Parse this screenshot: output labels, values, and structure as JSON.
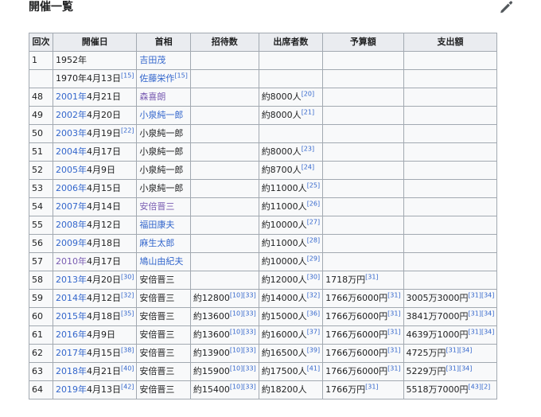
{
  "heading": "開催一覧",
  "edit_icon": "pencil-icon",
  "colors": {
    "link": "#3366cc",
    "visited": "#795cb2",
    "header_bg": "#eaecf0",
    "cell_bg": "#f8f9fa",
    "border": "#a2a9b1"
  },
  "headers": [
    "回次",
    "開催日",
    "首相",
    "招待数",
    "出席者数",
    "予算額",
    "支出額"
  ],
  "rows": [
    {
      "no": "1",
      "date": [
        {
          "t": "1952年"
        }
      ],
      "pm": {
        "t": "吉田茂",
        "c": "l-blue"
      }
    },
    {
      "no": "",
      "date": [
        {
          "t": "1970年4月13日"
        },
        {
          "s": "[15]"
        }
      ],
      "pm": {
        "t": "佐藤栄作",
        "c": "l-blue",
        "s": "[15]"
      }
    },
    {
      "no": "48",
      "date": [
        {
          "t": "2001年",
          "c": "l-blue"
        },
        {
          "t": "4月21日"
        }
      ],
      "pm": {
        "t": "森喜朗",
        "c": "l-visited"
      },
      "att": {
        "t": "約8000人",
        "s": "[20]"
      }
    },
    {
      "no": "49",
      "date": [
        {
          "t": "2002年",
          "c": "l-blue"
        },
        {
          "t": "4月20日"
        }
      ],
      "pm": {
        "t": "小泉純一郎",
        "c": "l-blue"
      },
      "att": {
        "t": "約8000人",
        "s": "[21]"
      }
    },
    {
      "no": "50",
      "date": [
        {
          "t": "2003年",
          "c": "l-blue"
        },
        {
          "t": "4月19日"
        },
        {
          "s": "[22]"
        }
      ],
      "pm": {
        "t": "小泉純一郎"
      }
    },
    {
      "no": "51",
      "date": [
        {
          "t": "2004年",
          "c": "l-blue"
        },
        {
          "t": "4月17日"
        }
      ],
      "pm": {
        "t": "小泉純一郎"
      },
      "att": {
        "t": "約8000人",
        "s": "[23]"
      }
    },
    {
      "no": "52",
      "date": [
        {
          "t": "2005年",
          "c": "l-blue"
        },
        {
          "t": "4月9日"
        }
      ],
      "pm": {
        "t": "小泉純一郎"
      },
      "att": {
        "t": "約8700人",
        "s": "[24]"
      }
    },
    {
      "no": "53",
      "date": [
        {
          "t": "2006年",
          "c": "l-blue"
        },
        {
          "t": "4月15日"
        }
      ],
      "pm": {
        "t": "小泉純一郎"
      },
      "att": {
        "t": "約11000人",
        "s": "[25]"
      }
    },
    {
      "no": "54",
      "date": [
        {
          "t": "2007年",
          "c": "l-blue"
        },
        {
          "t": "4月14日"
        }
      ],
      "pm": {
        "t": "安倍晋三",
        "c": "l-visited"
      },
      "att": {
        "t": "約11000人",
        "s": "[26]"
      }
    },
    {
      "no": "55",
      "date": [
        {
          "t": "2008年",
          "c": "l-blue"
        },
        {
          "t": "4月12日"
        }
      ],
      "pm": {
        "t": "福田康夫",
        "c": "l-blue"
      },
      "att": {
        "t": "約10000人",
        "s": "[27]"
      }
    },
    {
      "no": "56",
      "date": [
        {
          "t": "2009年",
          "c": "l-blue"
        },
        {
          "t": "4月18日"
        }
      ],
      "pm": {
        "t": "麻生太郎",
        "c": "l-blue"
      },
      "att": {
        "t": "約11000人",
        "s": "[28]"
      }
    },
    {
      "no": "57",
      "date": [
        {
          "t": "2010年",
          "c": "l-visited"
        },
        {
          "t": "4月17日"
        }
      ],
      "pm": {
        "t": "鳩山由紀夫",
        "c": "l-blue"
      },
      "att": {
        "t": "約10000人",
        "s": "[29]"
      }
    },
    {
      "no": "58",
      "date": [
        {
          "t": "2013年",
          "c": "l-blue"
        },
        {
          "t": "4月20日"
        },
        {
          "s": "[30]"
        }
      ],
      "pm": {
        "t": "安倍晋三"
      },
      "att": {
        "t": "約12000人",
        "s": "[30]"
      },
      "budget": {
        "t": "1718万円",
        "s": "[31]"
      }
    },
    {
      "no": "59",
      "date": [
        {
          "t": "2014年",
          "c": "l-blue"
        },
        {
          "t": "4月12日"
        },
        {
          "s": "[32]"
        }
      ],
      "pm": {
        "t": "安倍晋三"
      },
      "inv": {
        "t": "約12800",
        "s": "[10][33]"
      },
      "att": {
        "t": "約14000人",
        "s": "[32]"
      },
      "budget": {
        "t": "1766万6000円",
        "s": "[31]"
      },
      "spend": {
        "t": "3005万3000円",
        "s": "[31][34]"
      }
    },
    {
      "no": "60",
      "date": [
        {
          "t": "2015年",
          "c": "l-blue"
        },
        {
          "t": "4月18日"
        },
        {
          "s": "[35]"
        }
      ],
      "pm": {
        "t": "安倍晋三"
      },
      "inv": {
        "t": "約13600",
        "s": "[10][33]"
      },
      "att": {
        "t": "約15000人",
        "s": "[36]"
      },
      "budget": {
        "t": "1766万6000円",
        "s": "[31]"
      },
      "spend": {
        "t": "3841万7000円",
        "s": "[31][34]"
      }
    },
    {
      "no": "61",
      "date": [
        {
          "t": "2016年",
          "c": "l-blue"
        },
        {
          "t": "4月9日"
        }
      ],
      "pm": {
        "t": "安倍晋三"
      },
      "inv": {
        "t": "約13600",
        "s": "[10][33]"
      },
      "att": {
        "t": "約16000人",
        "s": "[37]"
      },
      "budget": {
        "t": "1766万6000円",
        "s": "[31]"
      },
      "spend": {
        "t": "4639万1000円",
        "s": "[31][34]"
      }
    },
    {
      "no": "62",
      "date": [
        {
          "t": "2017年",
          "c": "l-blue"
        },
        {
          "t": "4月15日"
        },
        {
          "s": "[38]"
        }
      ],
      "pm": {
        "t": "安倍晋三"
      },
      "inv": {
        "t": "約13900",
        "s": "[10][33]"
      },
      "att": {
        "t": "約16500人",
        "s": "[39]"
      },
      "budget": {
        "t": "1766万6000円",
        "s": "[31]"
      },
      "spend": {
        "t": "4725万円",
        "s": "[31][34]"
      }
    },
    {
      "no": "63",
      "date": [
        {
          "t": "2018年",
          "c": "l-blue"
        },
        {
          "t": "4月21日"
        },
        {
          "s": "[40]"
        }
      ],
      "pm": {
        "t": "安倍晋三"
      },
      "inv": {
        "t": "約15900",
        "s": "[10][33]"
      },
      "att": {
        "t": "約17500人",
        "s": "[41]"
      },
      "budget": {
        "t": "1766万6000円",
        "s": "[31]"
      },
      "spend": {
        "t": "5229万円",
        "s": "[31][34]"
      }
    },
    {
      "no": "64",
      "date": [
        {
          "t": "2019年",
          "c": "l-blue"
        },
        {
          "t": "4月13日"
        },
        {
          "s": "[42]"
        }
      ],
      "pm": {
        "t": "安倍晋三"
      },
      "inv": {
        "t": "約15400",
        "s": "[10][33]"
      },
      "att": {
        "t": "約18200人"
      },
      "budget": {
        "t": "1766万円",
        "s": "[31]"
      },
      "spend": {
        "t": "5518万7000円",
        "s": "[43][2]"
      }
    }
  ]
}
